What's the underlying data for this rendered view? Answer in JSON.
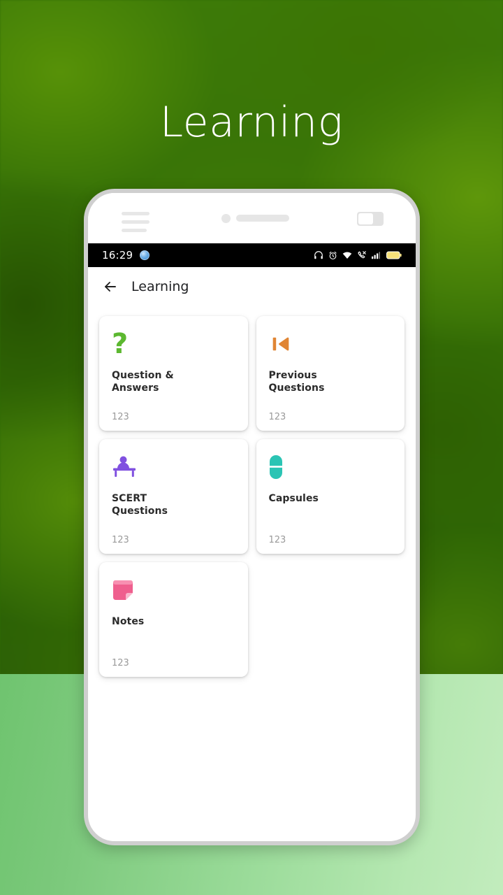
{
  "hero": {
    "title": "Learning"
  },
  "background": {
    "top_color": "#306d07",
    "band_left_color": "#6fc46f",
    "band_right_color": "#c2ecbd"
  },
  "device": {
    "frame_color": "#cfcfcf",
    "hamburger_icon": "hamburger-menu-icon",
    "camera_icon": "camera-dot-icon",
    "speaker_icon": "earpiece-speaker-icon",
    "toggle_icon": "device-toggle-icon"
  },
  "status_bar": {
    "time": "16:29",
    "app_icon": "app-notification-icon",
    "icons": [
      "headphones-icon",
      "alarm-clock-icon",
      "wifi-icon",
      "missed-call-icon",
      "signal-bars-icon",
      "battery-icon"
    ],
    "battery_color": "#f5e07a"
  },
  "app_bar": {
    "back_icon": "back-arrow-icon",
    "title": "Learning"
  },
  "cards": [
    {
      "title": "Question &\nAnswers",
      "count": "123",
      "icon": "question-mark-icon",
      "color": "#5cb830"
    },
    {
      "title": "Previous\nQuestions",
      "count": "123",
      "icon": "skip-previous-icon",
      "color": "#e08534"
    },
    {
      "title": "SCERT\nQuestions",
      "count": "123",
      "icon": "person-at-desk-icon",
      "color": "#8050e0"
    },
    {
      "title": "Capsules",
      "count": "123",
      "icon": "capsule-pill-icon",
      "color": "#2bc4b4"
    },
    {
      "title": "Notes",
      "count": "123",
      "icon": "sticky-note-icon",
      "color": "#ef5f8e"
    }
  ]
}
